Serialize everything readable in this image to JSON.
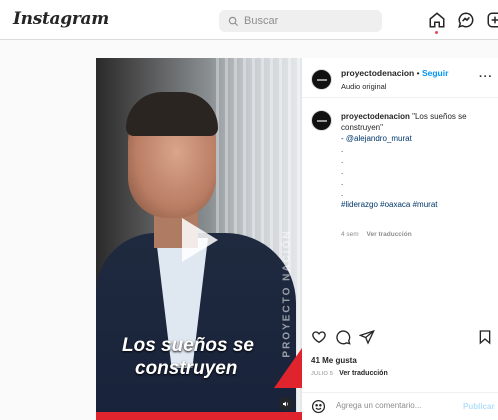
{
  "app": {
    "logo": "Instagram",
    "search_placeholder": "Buscar",
    "accent": "#0095f6",
    "notification_color": "#ed4956"
  },
  "nav": {
    "icons": [
      "home-icon",
      "messenger-icon",
      "new-post-icon"
    ]
  },
  "post": {
    "username": "proyectodenacion",
    "separator": "•",
    "follow_label": "Seguir",
    "audio": "Audio original",
    "more": "···",
    "video_caption_line1": "Los sueños se",
    "video_caption_line2": "construyen",
    "video_side_text": "PROYECTO NACIÓN",
    "caption": {
      "username": "proyectodenacion",
      "text": "\"Los sueños se construyen\"",
      "mention": "- @alejandro_murat",
      "dots": [
        ".",
        ".",
        ".",
        ".",
        "."
      ],
      "hashtags": "#liderazgo #oaxaca #murat"
    },
    "comment_age": "4 sem",
    "see_translation": "Ver traducción",
    "likes": "41 Me gusta",
    "date": "JULIO 5",
    "date_translation": "Ver traducción",
    "add_comment_placeholder": "Agrega un comentario...",
    "publish_label": "Publicar"
  }
}
